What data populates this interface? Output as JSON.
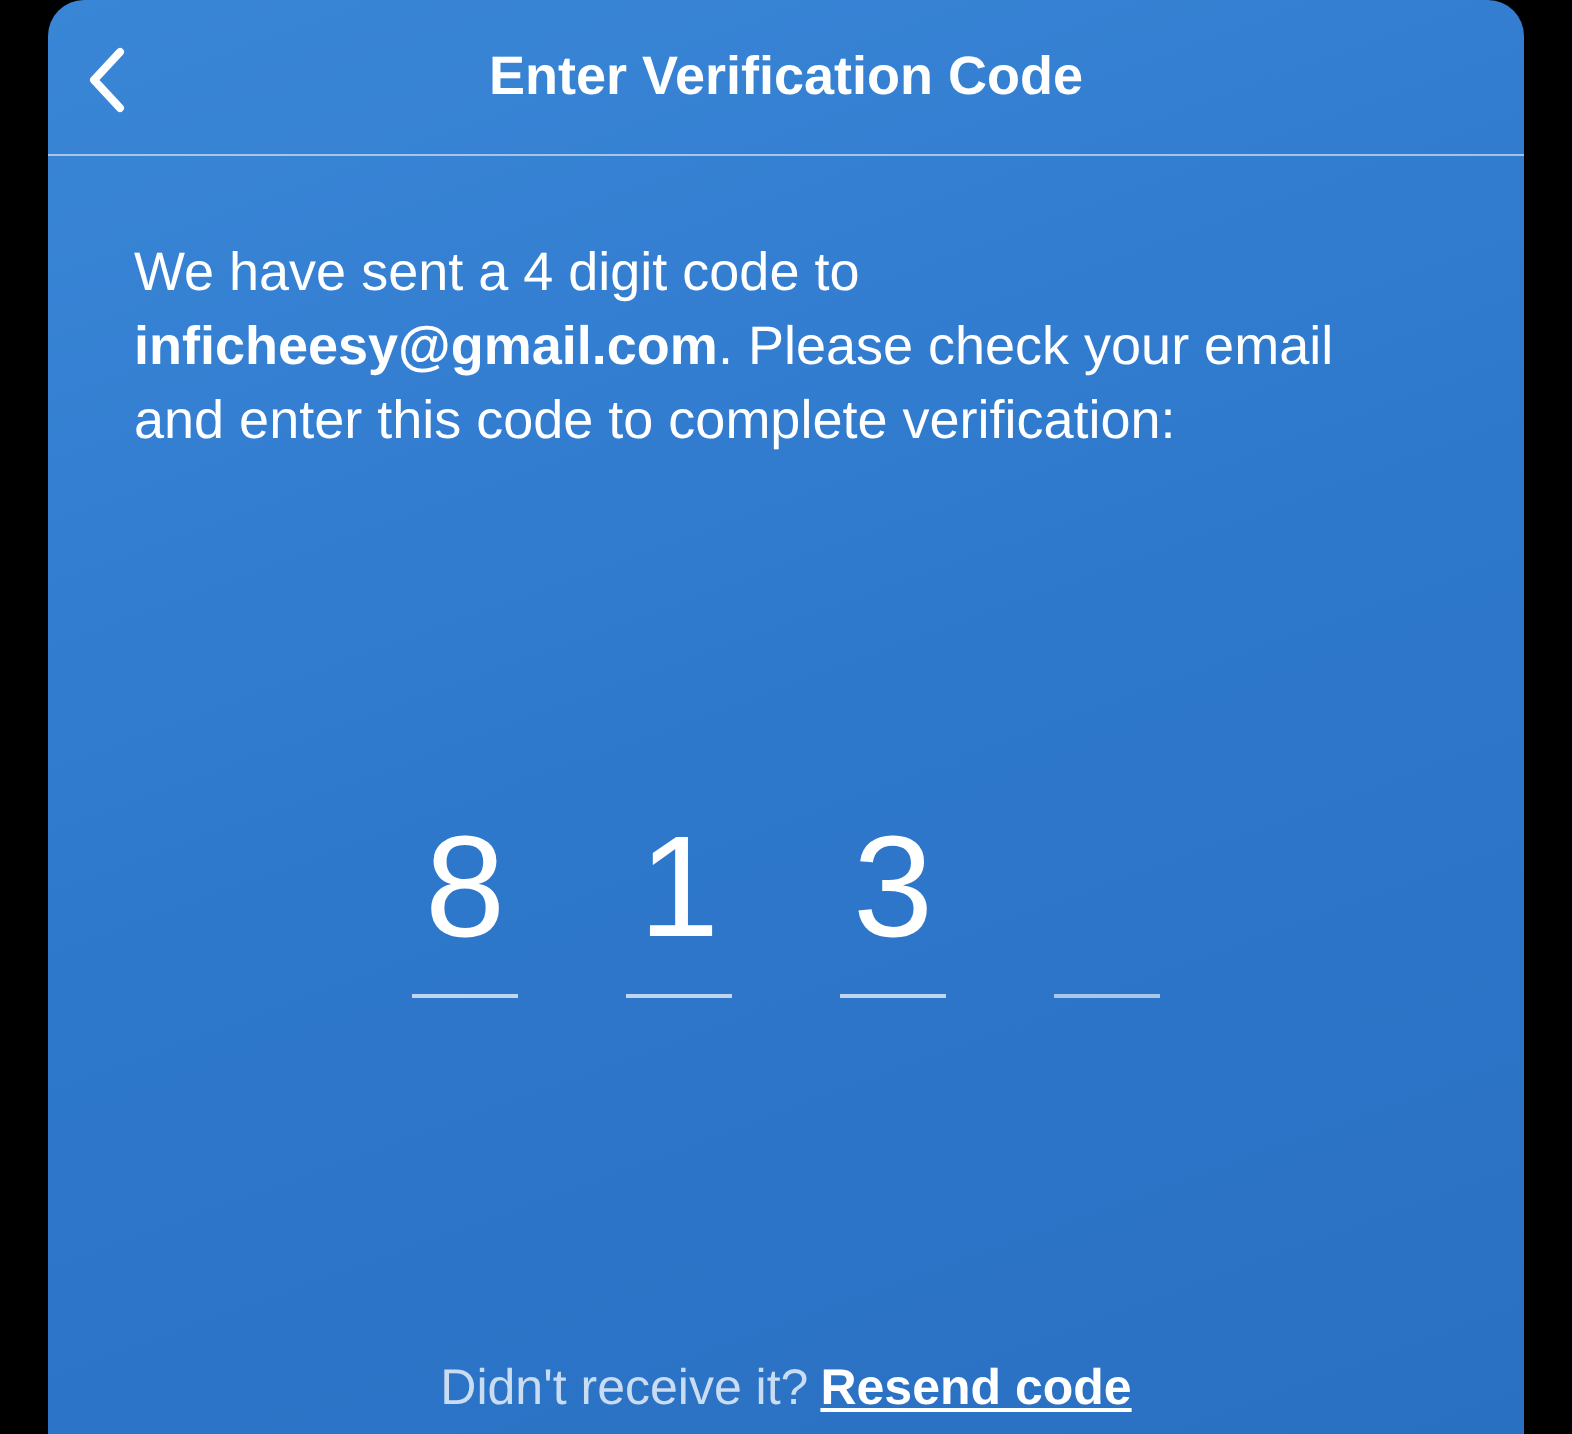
{
  "header": {
    "title": "Enter Verification Code"
  },
  "message": "We have sent a 4 digit code to **inficheesy@gmail.com**. Please check your email and enter this code to complete verification:",
  "code_slots": [
    {
      "digit": "8",
      "filled": true
    },
    {
      "digit": "1",
      "filled": true
    },
    {
      "digit": "3",
      "filled": true
    },
    {
      "filled": false
    }
  ],
  "footer": {
    "prompt": "Didn't receive it?",
    "link": "Resend code"
  }
}
